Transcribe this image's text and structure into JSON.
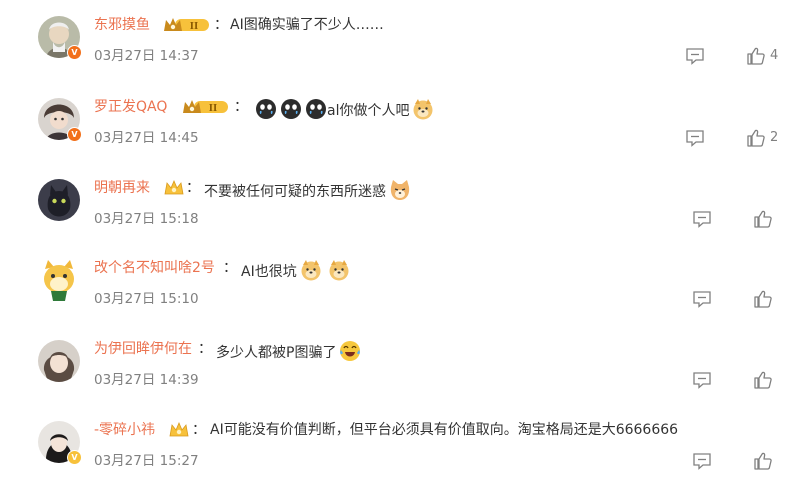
{
  "comments": [
    {
      "username": "东邪摸鱼",
      "level": "II",
      "text": "AI图确实骗了不少人……",
      "time": "03月27日 14:37",
      "likes": "4",
      "verified": "orange"
    },
    {
      "username": "罗正发QAQ",
      "level": "II",
      "text": "al你做个人吧",
      "time": "03月27日 14:45",
      "likes": "2",
      "verified": "orange"
    },
    {
      "username": "明朝再来",
      "level": "",
      "text": "不要被任何可疑的东西所迷惑",
      "time": "03月27日 15:18",
      "likes": "",
      "verified": ""
    },
    {
      "username": "改个名不知叫啥2号",
      "level": "",
      "text": "AI也很坑",
      "time": "03月27日 15:10",
      "likes": "",
      "verified": ""
    },
    {
      "username": "为伊回眸伊何在",
      "level": "",
      "text": "多少人都被P图骗了",
      "time": "03月27日 14:39",
      "likes": "",
      "verified": ""
    },
    {
      "username": "-零碎小祎",
      "level": "",
      "text": "AI可能没有价值判断，但平台必须具有价值取向。淘宝格局还是大6666666",
      "time": "03月27日 15:27",
      "likes": "",
      "verified": "yellow"
    }
  ],
  "colors": {
    "username": "#eb7350",
    "text": "#333333",
    "meta": "#808080",
    "badge_orange": "#f2701b",
    "badge_yellow": "#f7c13b"
  },
  "icons": {
    "reply": "comment-icon",
    "like": "thumbs-up-icon",
    "crown": "crown-level-badge",
    "v": "verified-v-badge"
  },
  "separator": "："
}
